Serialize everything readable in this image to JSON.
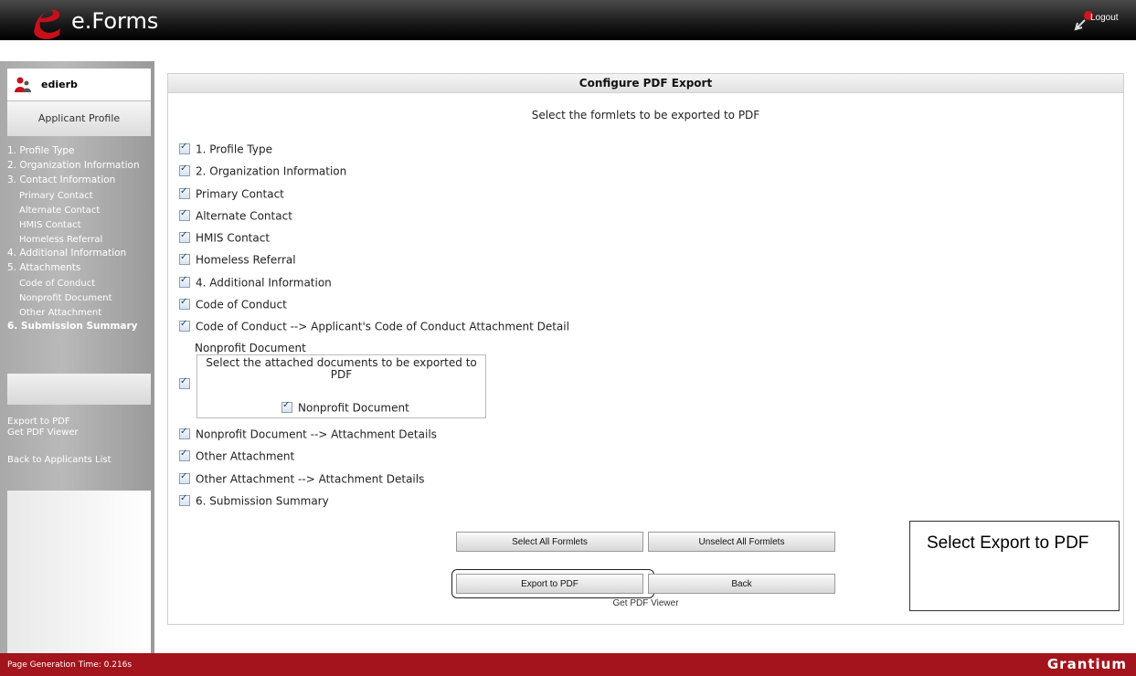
{
  "header": {
    "app_title": "e.Forms",
    "logout_label": "Logout"
  },
  "sidebar": {
    "user_name": "edierb",
    "section_title": "Applicant Profile",
    "nav": [
      "1. Profile Type",
      "2. Organization Information",
      "3. Contact Information",
      "Primary Contact",
      "Alternate Contact",
      "HMIS Contact",
      "Homeless Referral",
      "4. Additional Information",
      "5. Attachments",
      "Code of Conduct",
      "Nonprofit Document",
      "Other Attachment",
      "6. Submission Summary"
    ],
    "export_pdf": "Export to PDF",
    "get_viewer": "Get PDF Viewer",
    "back_list": "Back to Applicants List"
  },
  "main": {
    "title": "Configure PDF Export",
    "instructions": "Select the formlets to be exported to PDF",
    "formlets": [
      "1. Profile Type",
      "2. Organization Information",
      "Primary Contact",
      "Alternate Contact",
      "HMIS Contact",
      "Homeless Referral",
      "4. Additional Information",
      "Code of Conduct",
      "Code of Conduct --> Applicant's Code of Conduct Attachment Detail",
      "Nonprofit Document --> Attachment Details",
      "Other Attachment",
      "Other Attachment --> Attachment Details",
      "6. Submission Summary"
    ],
    "nonprofit": {
      "title": "Nonprofit Document",
      "box_text": "Select the attached documents to be exported to PDF",
      "item": "Nonprofit Document"
    },
    "buttons": {
      "select_all": "Select All Formlets",
      "unselect_all": "Unselect All Formlets",
      "export": "Export to PDF",
      "back": "Back"
    },
    "get_viewer": "Get PDF Viewer"
  },
  "callout": "Select Export to PDF",
  "footer": {
    "generation_time": "Page Generation Time: 0.216s",
    "brand": "Grantium"
  },
  "colors": {
    "header": "#000000",
    "footer": "#a3141d",
    "sidebar": "#b0b0b0"
  }
}
